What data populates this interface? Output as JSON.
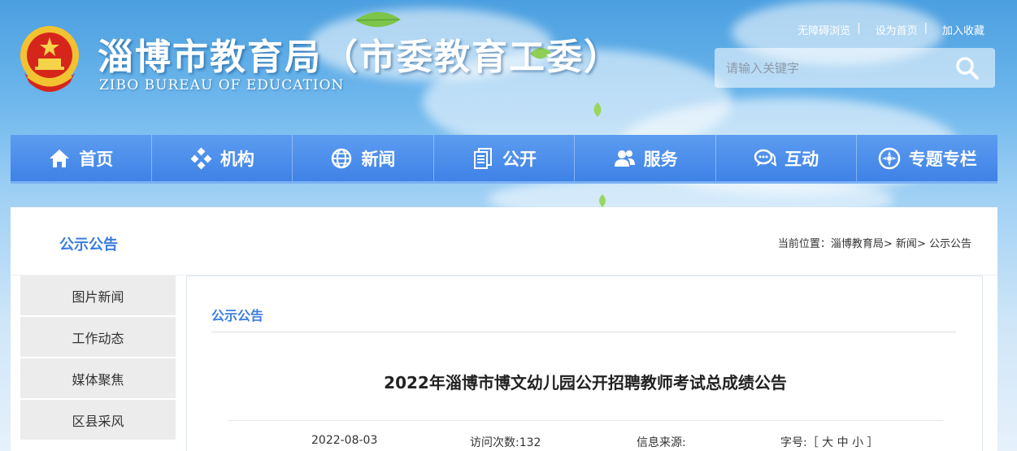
{
  "header": {
    "site_title": "淄博市教育局（市委教育工委）",
    "site_subtitle": "ZIBO BUREAU OF EDUCATION",
    "top_links": [
      "无障碍浏览",
      "设为首页",
      "加入收藏"
    ],
    "search_placeholder": "请输入关键字"
  },
  "nav": [
    {
      "label": "首页",
      "icon": "home-icon"
    },
    {
      "label": "机构",
      "icon": "organization-icon"
    },
    {
      "label": "新闻",
      "icon": "globe-icon"
    },
    {
      "label": "公开",
      "icon": "documents-icon"
    },
    {
      "label": "服务",
      "icon": "users-icon"
    },
    {
      "label": "互动",
      "icon": "chat-icon"
    },
    {
      "label": "专题专栏",
      "icon": "compass-icon"
    }
  ],
  "panel": {
    "title": "公示公告",
    "breadcrumb": {
      "prefix": "当前位置：",
      "items": [
        "淄博教育局",
        "新闻",
        "公示公告"
      ],
      "separator": ">"
    }
  },
  "sidebar": {
    "items": [
      "图片新闻",
      "工作动态",
      "媒体聚焦",
      "区县采风"
    ]
  },
  "main": {
    "section_title": "公示公告",
    "article_title": "2022年淄博市博文幼儿园公开招聘教师考试总成绩公告",
    "meta": {
      "date": "2022-08-03",
      "visits": "访问次数:132",
      "source": "信息来源:",
      "font_size": "字号:［ 大 中 小 ］"
    }
  },
  "colors": {
    "nav_blue": "#4a8ceb",
    "accent_blue": "#3b7de0",
    "sidebar_gray": "#ececec"
  }
}
